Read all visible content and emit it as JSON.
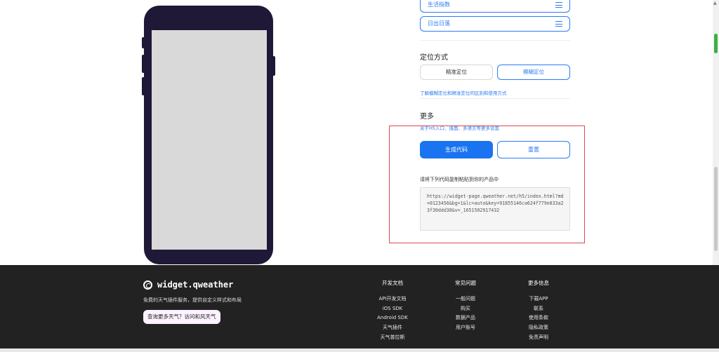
{
  "dropdowns": [
    {
      "label": "生活指数"
    },
    {
      "label": "日出日落"
    }
  ],
  "location": {
    "title": "定位方式",
    "option_precise": "精准定位",
    "option_fuzzy": "模糊定位",
    "help_link": "了解模糊定位和精准定位的区别和使用方式"
  },
  "more": {
    "title": "更多",
    "subtitle": "关于H5入口、值面、多语言等更多设置"
  },
  "actions": {
    "generate": "生成代码",
    "reset": "重置"
  },
  "code": {
    "hint": "请将下列代码复制粘贴到你的产品中",
    "value": "https://widget-page.qweather.net/h5/index.html?md=0123456&bg=1&lc=auto&key=91855146ca624f779e833a23f30ddd38&v=_1651502917432"
  },
  "footer": {
    "brand": "widget.qweather",
    "description": "免费的天气插件服务，提供自定义样式和布局",
    "cta": "查询更多天气？访问和风天气",
    "columns": [
      {
        "title": "开发文档",
        "items": [
          "API开发文档",
          "iOS SDK",
          "Android SDK",
          "天气插件",
          "天气普拉斯"
        ]
      },
      {
        "title": "常见问题",
        "items": [
          "一般问题",
          "购买",
          "数据产品",
          "用户账号"
        ]
      },
      {
        "title": "更多信息",
        "items": [
          "下载APP",
          "联系",
          "使用条款",
          "隐私政策",
          "免责声明"
        ]
      }
    ]
  },
  "colors": {
    "accent": "#1a73f0",
    "phone": "#1f1836",
    "footer_bg": "#222222",
    "highlight_border": "#e0474f"
  }
}
